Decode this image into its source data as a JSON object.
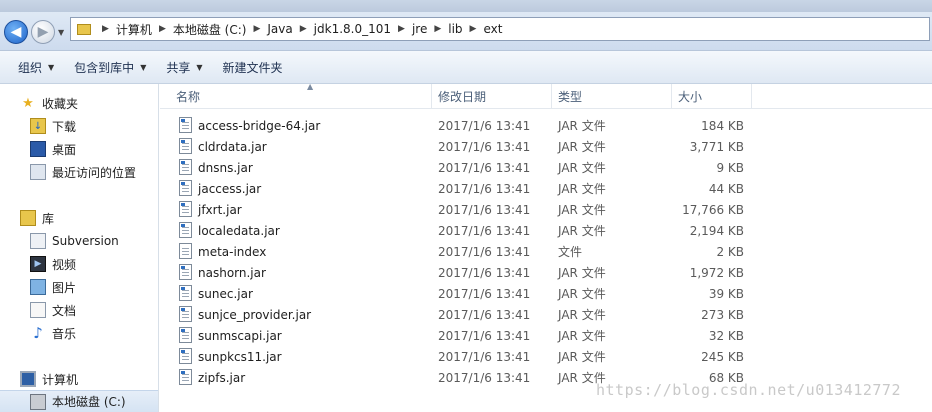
{
  "address": {
    "crumbs": [
      "计算机",
      "本地磁盘 (C:)",
      "Java",
      "jdk1.8.0_101",
      "jre",
      "lib",
      "ext"
    ]
  },
  "toolbar": {
    "organize": "组织",
    "include_in_library": "包含到库中",
    "share": "共享",
    "new_folder": "新建文件夹"
  },
  "nav": {
    "favorites": "收藏夹",
    "downloads": "下载",
    "desktop": "桌面",
    "recent_places": "最近访问的位置",
    "libraries": "库",
    "subversion": "Subversion",
    "videos": "视频",
    "pictures": "图片",
    "documents": "文档",
    "music": "音乐",
    "computer": "计算机",
    "local_disk_c": "本地磁盘 (C:)"
  },
  "columns": {
    "name": "名称",
    "modified": "修改日期",
    "type": "类型",
    "size": "大小"
  },
  "files": [
    {
      "name": "access-bridge-64.jar",
      "modified": "2017/1/6 13:41",
      "type": "JAR 文件",
      "size": "184 KB",
      "kind": "jar"
    },
    {
      "name": "cldrdata.jar",
      "modified": "2017/1/6 13:41",
      "type": "JAR 文件",
      "size": "3,771 KB",
      "kind": "jar"
    },
    {
      "name": "dnsns.jar",
      "modified": "2017/1/6 13:41",
      "type": "JAR 文件",
      "size": "9 KB",
      "kind": "jar"
    },
    {
      "name": "jaccess.jar",
      "modified": "2017/1/6 13:41",
      "type": "JAR 文件",
      "size": "44 KB",
      "kind": "jar"
    },
    {
      "name": "jfxrt.jar",
      "modified": "2017/1/6 13:41",
      "type": "JAR 文件",
      "size": "17,766 KB",
      "kind": "jar"
    },
    {
      "name": "localedata.jar",
      "modified": "2017/1/6 13:41",
      "type": "JAR 文件",
      "size": "2,194 KB",
      "kind": "jar"
    },
    {
      "name": "meta-index",
      "modified": "2017/1/6 13:41",
      "type": "文件",
      "size": "2 KB",
      "kind": "file"
    },
    {
      "name": "nashorn.jar",
      "modified": "2017/1/6 13:41",
      "type": "JAR 文件",
      "size": "1,972 KB",
      "kind": "jar"
    },
    {
      "name": "sunec.jar",
      "modified": "2017/1/6 13:41",
      "type": "JAR 文件",
      "size": "39 KB",
      "kind": "jar"
    },
    {
      "name": "sunjce_provider.jar",
      "modified": "2017/1/6 13:41",
      "type": "JAR 文件",
      "size": "273 KB",
      "kind": "jar"
    },
    {
      "name": "sunmscapi.jar",
      "modified": "2017/1/6 13:41",
      "type": "JAR 文件",
      "size": "32 KB",
      "kind": "jar"
    },
    {
      "name": "sunpkcs11.jar",
      "modified": "2017/1/6 13:41",
      "type": "JAR 文件",
      "size": "245 KB",
      "kind": "jar"
    },
    {
      "name": "zipfs.jar",
      "modified": "2017/1/6 13:41",
      "type": "JAR 文件",
      "size": "68 KB",
      "kind": "jar"
    }
  ],
  "watermark": "https://blog.csdn.net/u013412772",
  "colors": {
    "accent": "#1e63c9",
    "folder": "#e8c64c",
    "toolbar_text": "#1e3050"
  }
}
